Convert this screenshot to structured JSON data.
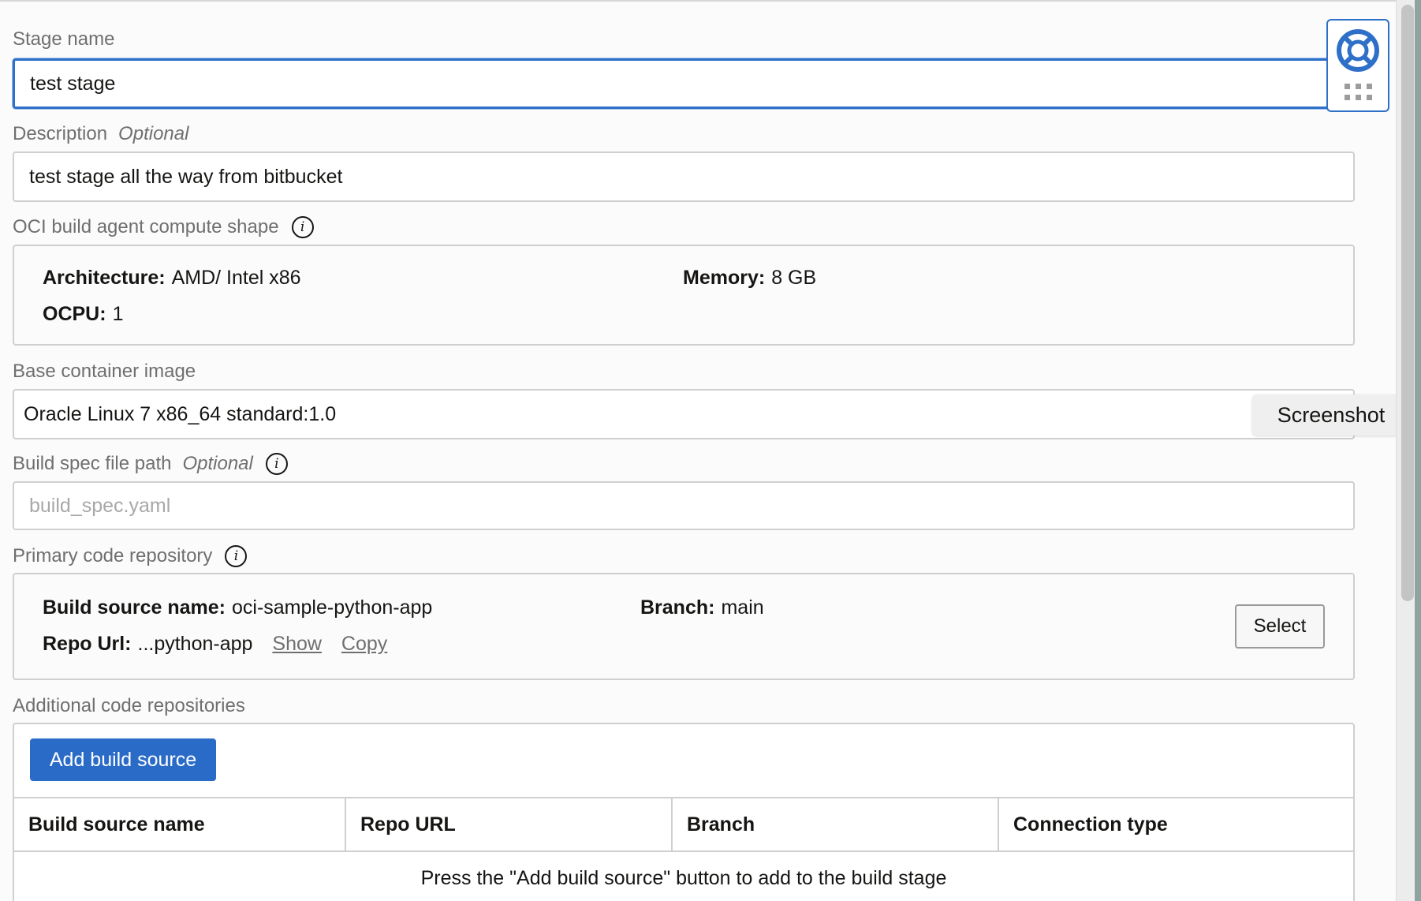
{
  "stage_name": {
    "label": "Stage name",
    "value": "test stage"
  },
  "description": {
    "label": "Description",
    "optional": "Optional",
    "value": "test stage all the way from bitbucket"
  },
  "compute_shape": {
    "label": "OCI build agent compute shape",
    "architecture_label": "Architecture:",
    "architecture_value": "AMD/ Intel x86",
    "memory_label": "Memory:",
    "memory_value": "8 GB",
    "ocpu_label": "OCPU:",
    "ocpu_value": "1"
  },
  "base_image": {
    "label": "Base container image",
    "value": "Oracle Linux 7 x86_64 standard:1.0"
  },
  "build_spec": {
    "label": "Build spec file path",
    "optional": "Optional",
    "placeholder": "build_spec.yaml"
  },
  "primary_repo": {
    "label": "Primary code repository",
    "source_name_label": "Build source name:",
    "source_name_value": "oci-sample-python-app",
    "branch_label": "Branch:",
    "branch_value": "main",
    "repo_url_label": "Repo Url:",
    "repo_url_value": "...python-app",
    "show_link": "Show",
    "copy_link": "Copy",
    "select_button": "Select"
  },
  "additional_repos": {
    "label": "Additional code repositories",
    "add_button": "Add build source",
    "columns": [
      "Build source name",
      "Repo URL",
      "Branch",
      "Connection type"
    ],
    "empty_message": "Press the \"Add build source\" button to add to the build stage"
  },
  "tooltip": "Screenshot",
  "icons": {
    "help": "lifebuoy-icon",
    "info": "info-icon",
    "drag": "drag-grip-icon"
  },
  "colors": {
    "accent": "#2e6fc8",
    "primary_button": "#2a6bc8"
  }
}
